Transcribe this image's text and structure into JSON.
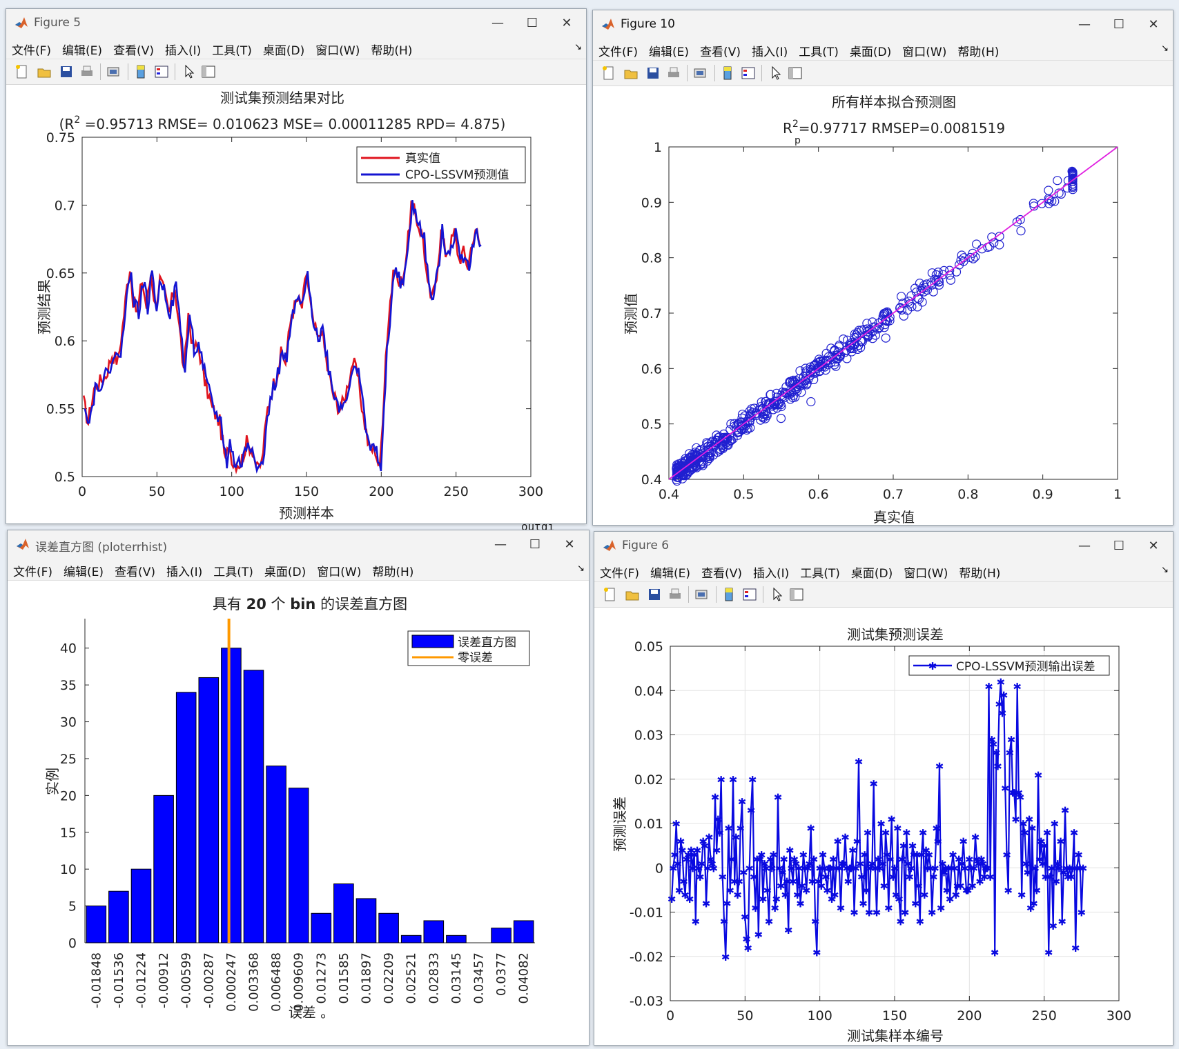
{
  "background": {
    "strip_text": "outdi"
  },
  "menus": [
    "文件(F)",
    "编辑(E)",
    "查看(V)",
    "插入(I)",
    "工具(T)",
    "桌面(D)",
    "窗口(W)",
    "帮助(H)"
  ],
  "windows": {
    "fig5": {
      "title": "Figure 5"
    },
    "fig10": {
      "title": "Figure 10"
    },
    "hist": {
      "title": "误差直方图 (ploterrhist)"
    },
    "fig6": {
      "title": "Figure 6"
    }
  },
  "chart_data": [
    {
      "id": "fig5",
      "type": "line",
      "title": "测试集预测结果对比",
      "subtitle_prefix": "(R",
      "subtitle_sup": "2",
      "subtitle_rest": " =0.95713 RMSE= 0.010623 MSE= 0.00011285 RPD= 4.875)",
      "xlabel": "预测样本",
      "ylabel": "预测结果",
      "xlim": [
        0,
        300
      ],
      "ylim": [
        0.5,
        0.75
      ],
      "xticks": [
        0,
        50,
        100,
        150,
        200,
        250,
        300
      ],
      "yticks": [
        0.5,
        0.55,
        0.6,
        0.65,
        0.7,
        0.75
      ],
      "legend_position": "top-right",
      "series": [
        {
          "name": "真实值",
          "color": "#e0141e",
          "shift": 0
        },
        {
          "name": "CPO-LSSVM预测值",
          "color": "#1414d2",
          "shift": 1
        }
      ],
      "anchors": [
        [
          1,
          0.555
        ],
        [
          4,
          0.54
        ],
        [
          8,
          0.565
        ],
        [
          12,
          0.57
        ],
        [
          16,
          0.575
        ],
        [
          20,
          0.59
        ],
        [
          24,
          0.585
        ],
        [
          27,
          0.61
        ],
        [
          30,
          0.64
        ],
        [
          32,
          0.655
        ],
        [
          34,
          0.63
        ],
        [
          37,
          0.62
        ],
        [
          40,
          0.645
        ],
        [
          43,
          0.625
        ],
        [
          46,
          0.65
        ],
        [
          49,
          0.625
        ],
        [
          52,
          0.645
        ],
        [
          55,
          0.635
        ],
        [
          58,
          0.62
        ],
        [
          62,
          0.64
        ],
        [
          66,
          0.6
        ],
        [
          68,
          0.575
        ],
        [
          71,
          0.62
        ],
        [
          74,
          0.595
        ],
        [
          78,
          0.595
        ],
        [
          82,
          0.57
        ],
        [
          87,
          0.55
        ],
        [
          92,
          0.54
        ],
        [
          96,
          0.51
        ],
        [
          98,
          0.525
        ],
        [
          101,
          0.51
        ],
        [
          106,
          0.51
        ],
        [
          110,
          0.525
        ],
        [
          114,
          0.52
        ],
        [
          117,
          0.505
        ],
        [
          120,
          0.51
        ],
        [
          124,
          0.55
        ],
        [
          127,
          0.565
        ],
        [
          130,
          0.575
        ],
        [
          133,
          0.59
        ],
        [
          136,
          0.585
        ],
        [
          140,
          0.62
        ],
        [
          144,
          0.63
        ],
        [
          147,
          0.625
        ],
        [
          150,
          0.65
        ],
        [
          154,
          0.615
        ],
        [
          158,
          0.6
        ],
        [
          160,
          0.61
        ],
        [
          164,
          0.58
        ],
        [
          168,
          0.56
        ],
        [
          172,
          0.55
        ],
        [
          175,
          0.555
        ],
        [
          178,
          0.57
        ],
        [
          181,
          0.585
        ],
        [
          184,
          0.575
        ],
        [
          188,
          0.545
        ],
        [
          192,
          0.52
        ],
        [
          196,
          0.52
        ],
        [
          199,
          0.505
        ],
        [
          201,
          0.545
        ],
        [
          203,
          0.59
        ],
        [
          206,
          0.63
        ],
        [
          209,
          0.655
        ],
        [
          212,
          0.64
        ],
        [
          215,
          0.65
        ],
        [
          218,
          0.675
        ],
        [
          220,
          0.7
        ],
        [
          222,
          0.695
        ],
        [
          225,
          0.685
        ],
        [
          228,
          0.675
        ],
        [
          231,
          0.64
        ],
        [
          234,
          0.63
        ],
        [
          237,
          0.65
        ],
        [
          240,
          0.68
        ],
        [
          243,
          0.665
        ],
        [
          246,
          0.67
        ],
        [
          249,
          0.68
        ],
        [
          252,
          0.66
        ],
        [
          255,
          0.665
        ],
        [
          258,
          0.655
        ],
        [
          261,
          0.675
        ],
        [
          264,
          0.68
        ],
        [
          266,
          0.67
        ]
      ]
    },
    {
      "id": "fig10",
      "type": "scatter",
      "title": "所有样本拟合预测图",
      "subtitle_r": "R",
      "subtitle_sub": "p",
      "subtitle_sup": "2",
      "subtitle_rest": "=0.97717  RMSEP=0.0081519",
      "xlabel": "真实值",
      "ylabel": "预测值",
      "xlim": [
        0.4,
        1
      ],
      "ylim": [
        0.4,
        1
      ],
      "xticks": [
        0.4,
        0.5,
        0.6,
        0.7,
        0.8,
        0.9,
        1
      ],
      "yticks": [
        0.4,
        0.5,
        0.6,
        0.7,
        0.8,
        0.9,
        1
      ],
      "marker_color": "#2020d0",
      "fit_line_color": "#e020e0",
      "outliers": [
        [
          0.55,
          0.51
        ],
        [
          0.69,
          0.655
        ],
        [
          0.59,
          0.54
        ]
      ]
    },
    {
      "id": "hist",
      "type": "bar",
      "title_pre": "具有 ",
      "title_bold1": "20",
      "title_mid": " 个 ",
      "title_bold2": "bin",
      "title_post": " 的误差直方图",
      "xlabel": "误差 。",
      "ylabel": "实例",
      "categories": [
        "-0.01848",
        "-0.01536",
        "-0.01224",
        "-0.00912",
        "-0.00599",
        "-0.00287",
        "0.000247",
        "0.003368",
        "0.006488",
        "0.009609",
        "0.01273",
        "0.01585",
        "0.01897",
        "0.02209",
        "0.02521",
        "0.02833",
        "0.03145",
        "0.03457",
        "0.0377",
        "0.04082"
      ],
      "values": [
        5,
        7,
        10,
        20,
        34,
        36,
        40,
        37,
        24,
        21,
        4,
        8,
        6,
        4,
        1,
        3,
        1,
        0,
        2,
        3
      ],
      "ylim": [
        0,
        44
      ],
      "yticks": [
        0,
        5,
        10,
        15,
        20,
        25,
        30,
        35,
        40
      ],
      "zero_error_index": 5.9,
      "legend": [
        {
          "name": "误差直方图",
          "color": "#0000ff"
        },
        {
          "name": "零误差",
          "color": "#ff9900"
        }
      ],
      "legend_position": "top-right"
    },
    {
      "id": "fig6",
      "type": "line",
      "title": "测试集预测误差",
      "xlabel": "测试集样本编号",
      "ylabel": "预测误差",
      "xlim": [
        0,
        300
      ],
      "ylim": [
        -0.03,
        0.05
      ],
      "xticks": [
        0,
        50,
        100,
        150,
        200,
        250,
        300
      ],
      "yticks": [
        -0.03,
        -0.02,
        -0.01,
        0,
        0.01,
        0.02,
        0.03,
        0.04,
        0.05
      ],
      "grid": true,
      "legend_position": "top-right",
      "series": [
        {
          "name": "CPO-LSSVM预测输出误差",
          "color": "#0a0ae0"
        }
      ],
      "values": [
        -0.007,
        0.0,
        0.003,
        0.01,
        0.001,
        -0.005,
        0.006,
        0.004,
        -0.003,
        -0.006,
        0.002,
        0.003,
        -0.007,
        0.004,
        0.0,
        0.003,
        -0.012,
        0.004,
        0.0,
        -0.002,
        0.001,
        0.006,
        0.005,
        -0.008,
        0.0,
        0.007,
        0.002,
        0.001,
        0.0,
        0.016,
        0.004,
        0.011,
        0.008,
        0.02,
        -0.002,
        -0.012,
        -0.02,
        -0.008,
        0.009,
        -0.005,
        0.002,
        0.02,
        -0.003,
        0.007,
        -0.006,
        -0.003,
        0.009,
        0.015,
        -0.001,
        -0.011,
        -0.016,
        -0.018,
        0.0,
        0.013,
        0.02,
        -0.002,
        -0.009,
        0.002,
        -0.015,
        0.002,
        0.003,
        -0.007,
        0.001,
        0.0,
        -0.005,
        -0.012,
        0.002,
        0.0,
        0.003,
        -0.009,
        -0.007,
        0.016,
        0.0,
        -0.004,
        -0.001,
        0.002,
        -0.006,
        -0.003,
        -0.014,
        0.004,
        0.0,
        -0.003,
        0.002,
        0.001,
        -0.006,
        0.0,
        -0.008,
        -0.004,
        0.003,
        0.0,
        -0.005,
        0.0,
        0.001,
        0.009,
        -0.003,
        0.002,
        -0.012,
        -0.019,
        -0.003,
        0.0,
        -0.004,
        0.003,
        0.0,
        -0.002,
        -0.005,
        0.0,
        0.0,
        -0.007,
        0.002,
        -0.006,
        0.0,
        0.006,
        0.0,
        -0.009,
        0.001,
        0.001,
        0.007,
        0.0,
        -0.003,
        0.0,
        0.0,
        0.004,
        -0.01,
        0.0,
        0.006,
        0.024,
        0.001,
        -0.002,
        -0.008,
        0.003,
        -0.005,
        0.008,
        -0.01,
        0.0,
        0.001,
        0.019,
        0.0,
        -0.01,
        0.002,
        0.0,
        0.01,
        0.001,
        -0.004,
        0.008,
        0.003,
        -0.009,
        0.002,
        0.011,
        -0.002,
        0.0,
        -0.006,
        0.009,
        -0.007,
        -0.012,
        0.002,
        0.005,
        -0.01,
        0.008,
        0.001,
        -0.002,
        0.0,
        0.005,
        0.003,
        -0.008,
        0.003,
        -0.004,
        -0.012,
        0.003,
        0.008,
        -0.006,
        0.004,
        0.0,
        0.003,
        0.0,
        -0.01,
        -0.002,
        0.0,
        0.009,
        0.006,
        0.023,
        -0.009,
        0.001,
        -0.001,
        0.0,
        -0.005,
        0.0,
        -0.007,
        0.0,
        0.003,
        0.0,
        -0.006,
        -0.004,
        0.002,
        -0.004,
        0.001,
        0.006,
        0.0,
        -0.005,
        -0.005,
        0.002,
        0.0,
        -0.004,
        0.0,
        0.007,
        0.002,
        0.001,
        -0.003,
        0.002,
        0.001,
        -0.002,
        0.0,
        0.0,
        0.041,
        -0.002,
        0.029,
        0.028,
        -0.019,
        0.026,
        0.023,
        0.037,
        0.042,
        0.035,
        0.039,
        0.018,
        0.003,
        -0.005,
        0.026,
        0.029,
        0.017,
        0.017,
        0.011,
        0.041,
        0.017,
        0.016,
        -0.006,
        0.01,
        0.008,
        0.001,
        -0.001,
        0.011,
        -0.009,
        0.009,
        -0.008,
        0.0,
        -0.005,
        0.021,
        0.002,
        0.006,
        0.001,
        0.005,
        -0.002,
        0.008,
        -0.019,
        -0.002,
        0.0,
        -0.013,
        0.01,
        -0.003,
        0.001,
        0.0,
        0.006,
        -0.012,
        -0.001,
        0.013,
        0.0,
        -0.002,
        0.0,
        -0.002,
        0.0,
        0.008,
        -0.018,
        0.0,
        0.003,
        0.0,
        -0.01,
        0.0
      ]
    }
  ]
}
